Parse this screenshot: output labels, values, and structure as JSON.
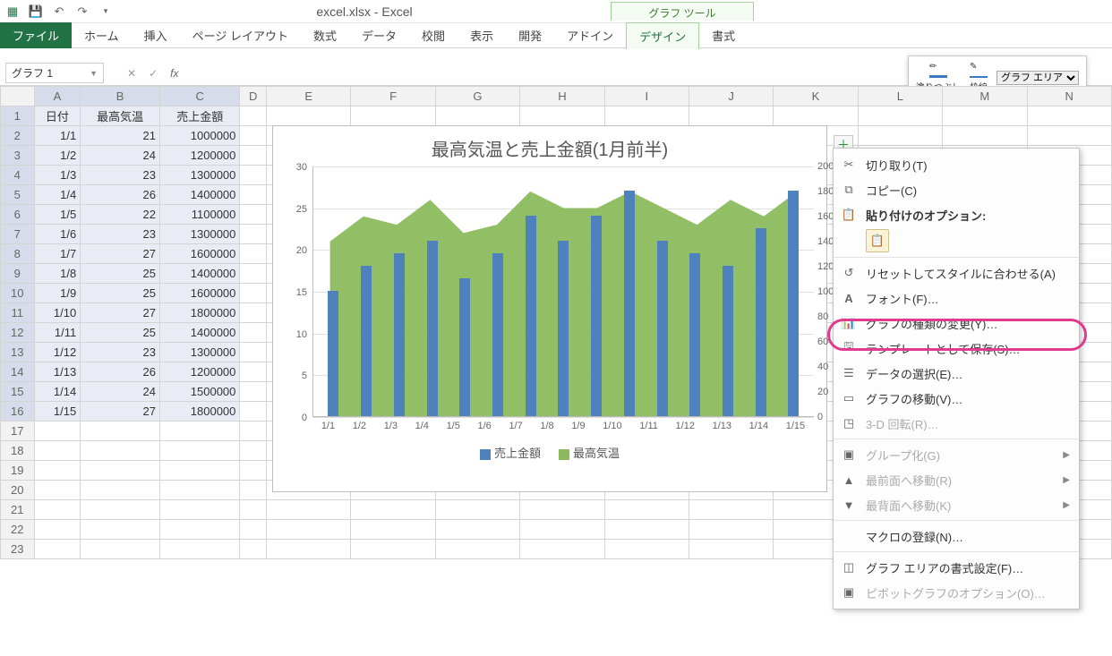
{
  "app": {
    "title": "excel.xlsx - Excel",
    "chart_tools": "グラフ ツール"
  },
  "tabs": {
    "file": "ファイル",
    "home": "ホーム",
    "insert": "挿入",
    "layout": "ページ レイアウト",
    "formula": "数式",
    "data": "データ",
    "review": "校閲",
    "view": "表示",
    "dev": "開発",
    "addin": "アドイン",
    "design": "デザイン",
    "format": "書式"
  },
  "namebox": "グラフ 1",
  "format_panel": {
    "fill": "塗りつぶし",
    "outline": "枠線",
    "selector": "グラフ エリア"
  },
  "table": {
    "headers": {
      "a": "日付",
      "b": "最高気温",
      "c": "売上金額"
    },
    "cols": [
      "A",
      "B",
      "C",
      "D",
      "E",
      "F",
      "G",
      "H",
      "I",
      "J",
      "K",
      "L",
      "M",
      "N"
    ],
    "rows": [
      {
        "a": "1/1",
        "b": 21,
        "c": 1000000
      },
      {
        "a": "1/2",
        "b": 24,
        "c": 1200000
      },
      {
        "a": "1/3",
        "b": 23,
        "c": 1300000
      },
      {
        "a": "1/4",
        "b": 26,
        "c": 1400000
      },
      {
        "a": "1/5",
        "b": 22,
        "c": 1100000
      },
      {
        "a": "1/6",
        "b": 23,
        "c": 1300000
      },
      {
        "a": "1/7",
        "b": 27,
        "c": 1600000
      },
      {
        "a": "1/8",
        "b": 25,
        "c": 1400000
      },
      {
        "a": "1/9",
        "b": 25,
        "c": 1600000
      },
      {
        "a": "1/10",
        "b": 27,
        "c": 1800000
      },
      {
        "a": "1/11",
        "b": 25,
        "c": 1400000
      },
      {
        "a": "1/12",
        "b": 23,
        "c": 1300000
      },
      {
        "a": "1/13",
        "b": 26,
        "c": 1200000
      },
      {
        "a": "1/14",
        "b": 24,
        "c": 1500000
      },
      {
        "a": "1/15",
        "b": 27,
        "c": 1800000
      }
    ]
  },
  "chart_data": {
    "type": "bar",
    "title": "最高気温と売上金額(1月前半)",
    "categories": [
      "1/1",
      "1/2",
      "1/3",
      "1/4",
      "1/5",
      "1/6",
      "1/7",
      "1/8",
      "1/9",
      "1/10",
      "1/11",
      "1/12",
      "1/13",
      "1/14",
      "1/15"
    ],
    "series": [
      {
        "name": "売上金額",
        "type": "bar",
        "axis": "secondary",
        "values": [
          100,
          120,
          130,
          140,
          110,
          130,
          160,
          140,
          160,
          180,
          140,
          130,
          120,
          150,
          180
        ]
      },
      {
        "name": "最高気温",
        "type": "area",
        "axis": "primary",
        "values": [
          21,
          24,
          23,
          26,
          22,
          23,
          27,
          25,
          25,
          27,
          25,
          23,
          26,
          24,
          27
        ]
      }
    ],
    "ylabel": "",
    "ylim": [
      0,
      30
    ],
    "yticks": [
      0,
      5,
      10,
      15,
      20,
      25,
      30
    ],
    "y2lim": [
      0,
      200
    ],
    "y2ticks": [
      0,
      20,
      40,
      60,
      80,
      100,
      120,
      140,
      160,
      180,
      200
    ],
    "legend": [
      "売上金額",
      "最高気温"
    ]
  },
  "context_menu": {
    "cut": "切り取り(T)",
    "copy": "コピー(C)",
    "paste_header": "貼り付けのオプション:",
    "reset": "リセットしてスタイルに合わせる(A)",
    "font": "フォント(F)…",
    "change_type": "グラフの種類の変更(Y)…",
    "save_template": "テンプレートとして保存(S)…",
    "select_data": "データの選択(E)…",
    "move_chart": "グラフの移動(V)…",
    "rotate3d": "3-D 回転(R)…",
    "group": "グループ化(G)",
    "front": "最前面へ移動(R)",
    "back": "最背面へ移動(K)",
    "macro": "マクロの登録(N)…",
    "format_area": "グラフ エリアの書式設定(F)…",
    "pivot_opt": "ピボットグラフのオプション(O)…"
  }
}
